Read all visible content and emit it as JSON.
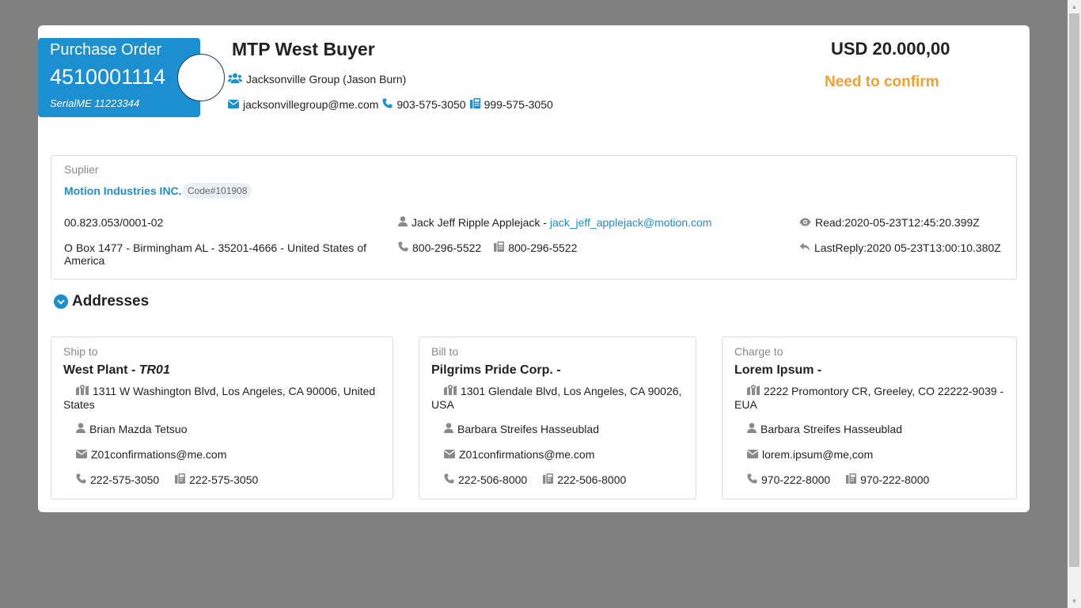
{
  "po": {
    "title": "Purchase Order",
    "number": "4510001114",
    "serial": "SerialME 11223344"
  },
  "buyer": {
    "name": "MTP West Buyer",
    "group": "Jacksonville Group (Jason Burn)",
    "email": "jacksonvillegroup@me.com",
    "phone": "903-575-3050",
    "fax": "999-575-3050"
  },
  "amount": "USD 20.000,00",
  "status": {
    "label": "Need to confirm",
    "color": "#f0a030"
  },
  "supplier": {
    "section_label": "Suplier",
    "name": "Motion Industries INC.",
    "code": "Code#101908",
    "tax_id": "00.823.053/0001-02",
    "address": "O Box 1477 - Birmingham AL - 35201-4666 - United States of America",
    "contact_name": "Jack Jeff Ripple Applejack -",
    "contact_email": "jack_jeff_applejack@motion.com",
    "phone": "800-296-5522",
    "fax": "800-296-5522",
    "read": "Read:2020-05-23T12:45:20.399Z",
    "last_reply": "LastReply:2020 05-23T13:00:10.380Z"
  },
  "addresses": {
    "title": "Addresses",
    "ship_to": {
      "label": "Ship to",
      "name": "West Plant - ",
      "code": "TR01",
      "street": "1311 W Washington Blvd, Los Angeles, CA 90006, United States",
      "contact": "Brian Mazda Tetsuo",
      "email": "Z01confirmations@me.com",
      "phone": "222-575-3050",
      "fax": "222-575-3050"
    },
    "bill_to": {
      "label": "Bill to",
      "name": "Pilgrims Pride Corp. -",
      "street": "1301 Glendale Blvd, Los Angeles, CA 90026, USA",
      "contact": "Barbara Streifes Hasseublad",
      "email": "Z01confirmations@me.com",
      "phone": "222-506-8000",
      "fax": "222-506-8000"
    },
    "charge_to": {
      "label": "Charge to",
      "name": "Lorem Ipsum -",
      "street": "2222 Promontory CR, Greeley, CO 22222-9039 - EUA",
      "contact": "Barbara Streifes Hasseublad",
      "email": "lorem.ipsum@me,com",
      "phone": "970-222-8000",
      "fax": "970-222-8000"
    }
  },
  "accent_color": "#1b8fd0"
}
